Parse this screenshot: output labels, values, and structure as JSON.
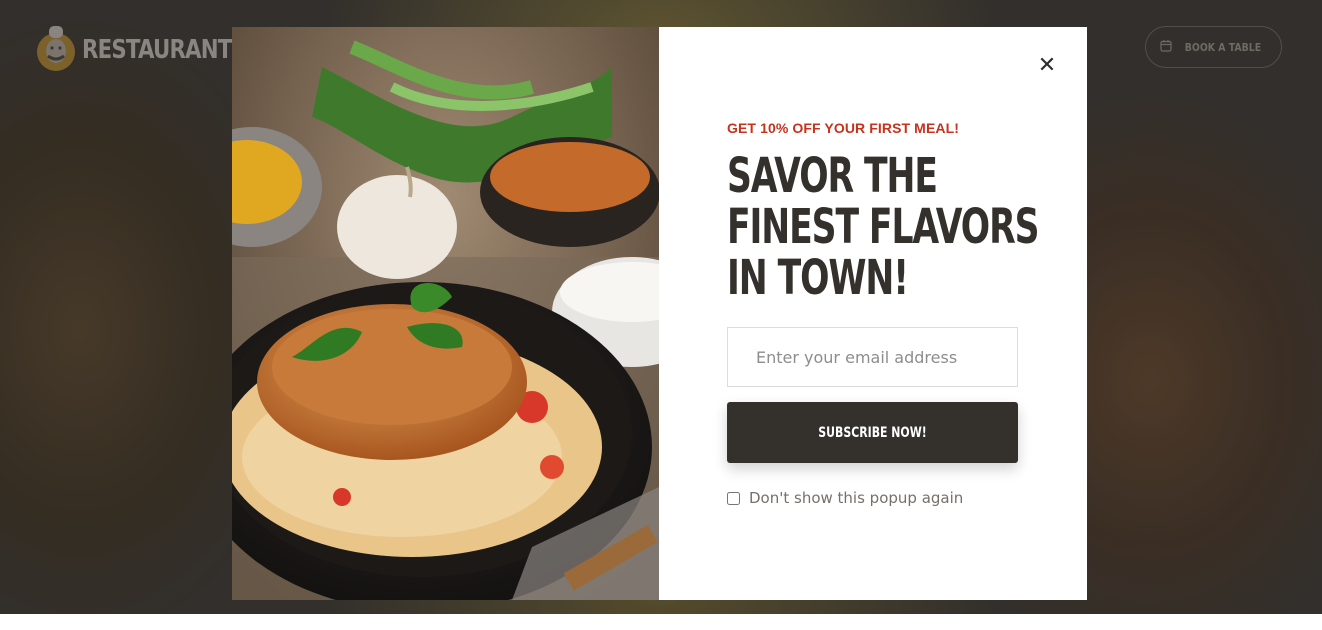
{
  "site": {
    "logo_text": "RESTAURANT",
    "book_button_label": "BOOK A TABLE",
    "icons": {
      "logo": "chef-logo-icon",
      "book": "calendar-icon"
    }
  },
  "popup": {
    "eyebrow": "GET 10% OFF YOUR FIRST MEAL!",
    "headline_lines": [
      "SAVOR THE",
      "FINEST FLAVORS",
      "IN TOWN!"
    ],
    "email_placeholder": "Enter your email address",
    "subscribe_label": "SUBSCRIBE NOW!",
    "dont_show_label": "Don't show this popup again",
    "dont_show_checked": false,
    "close_icon": "close-icon",
    "image_subject": "plate of rice with fried patty, garlic, greens and dipping sauces"
  },
  "colors": {
    "accent_red": "#c8321d",
    "dark": "#34312d",
    "gold": "#c79a3b"
  }
}
